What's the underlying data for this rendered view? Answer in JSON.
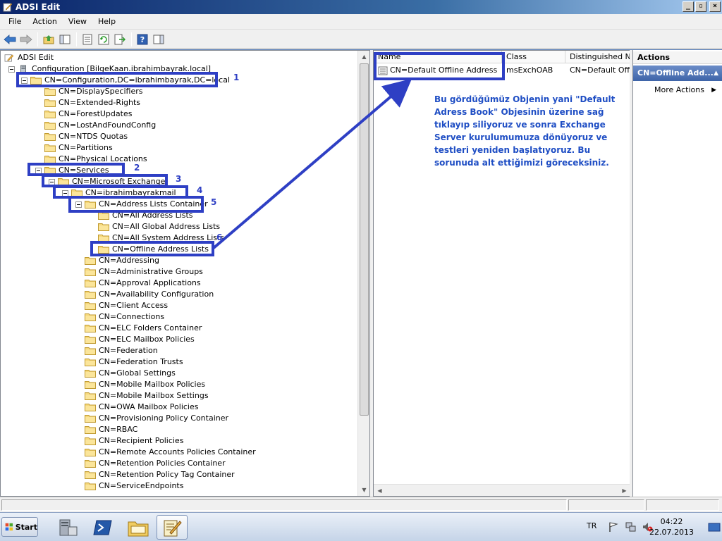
{
  "window": {
    "title": "ADSI Edit"
  },
  "menu": [
    "File",
    "Action",
    "View",
    "Help"
  ],
  "toolbar": [
    "back-icon",
    "forward-icon",
    "up-folder-icon",
    "show-hide-tree-icon",
    "properties-icon",
    "refresh-icon",
    "export-list-icon",
    "help-icon",
    "show-hide-action-pane-icon"
  ],
  "tree": {
    "items": [
      {
        "label": "ADSI Edit",
        "icon": "adsi-edit-icon"
      },
      {
        "label": "Configuration [BilgeKaan.ibrahimbayrak.local]",
        "icon": "server-icon"
      },
      {
        "label": "CN=Configuration,DC=ibrahimbayrak,DC=local"
      },
      {
        "label": "CN=DisplaySpecifiers"
      },
      {
        "label": "CN=Extended-Rights"
      },
      {
        "label": "CN=ForestUpdates"
      },
      {
        "label": "CN=LostAndFoundConfig"
      },
      {
        "label": "CN=NTDS Quotas"
      },
      {
        "label": "CN=Partitions"
      },
      {
        "label": "CN=Physical Locations"
      },
      {
        "label": "CN=Services"
      },
      {
        "label": "CN=Microsoft Exchange"
      },
      {
        "label": "CN=ibrahimbayrakmail"
      },
      {
        "label": "CN=Address Lists Container"
      },
      {
        "label": "CN=All Address Lists"
      },
      {
        "label": "CN=All Global Address Lists"
      },
      {
        "label": "CN=All System Address Lists"
      },
      {
        "label": "CN=Offline Address Lists"
      },
      {
        "label": "CN=Addressing"
      },
      {
        "label": "CN=Administrative Groups"
      },
      {
        "label": "CN=Approval Applications"
      },
      {
        "label": "CN=Availability Configuration"
      },
      {
        "label": "CN=Client Access"
      },
      {
        "label": "CN=Connections"
      },
      {
        "label": "CN=ELC Folders Container"
      },
      {
        "label": "CN=ELC Mailbox Policies"
      },
      {
        "label": "CN=Federation"
      },
      {
        "label": "CN=Federation Trusts"
      },
      {
        "label": "CN=Global Settings"
      },
      {
        "label": "CN=Mobile Mailbox Policies"
      },
      {
        "label": "CN=Mobile Mailbox Settings"
      },
      {
        "label": "CN=OWA Mailbox Policies"
      },
      {
        "label": "CN=Provisioning Policy Container"
      },
      {
        "label": "CN=RBAC"
      },
      {
        "label": "CN=Recipient Policies"
      },
      {
        "label": "CN=Remote Accounts Policies Container"
      },
      {
        "label": "CN=Retention Policies Container"
      },
      {
        "label": "CN=Retention Policy Tag Container"
      },
      {
        "label": "CN=ServiceEndpoints"
      }
    ]
  },
  "annotations": [
    "1",
    "2",
    "3",
    "4",
    "5",
    "6"
  ],
  "annotation_color": "#2e3fc4",
  "list": {
    "columns": [
      "Name",
      "Class",
      "Distinguished Name"
    ],
    "rows": [
      {
        "name": "CN=Default Offline Address B...",
        "class": "msExchOAB",
        "dn": "CN=Default Offlin"
      }
    ]
  },
  "note_text": "Bu gördüğümüz Objenin yani \"Default Adress Book\" Objesinin üzerine sağ tıklayıp siliyoruz ve sonra Exchange Server kurulumumuza dönüyoruz ve testleri yeniden başlatıyoruz. Bu sorunuda alt ettiğimizi göreceksiniz.",
  "actions": {
    "header": "Actions",
    "selected": "CN=Offline Add...",
    "more": "More Actions"
  },
  "taskbar": {
    "start": "Start",
    "language": "TR",
    "time": "04:22",
    "date": "22.07.2013"
  }
}
